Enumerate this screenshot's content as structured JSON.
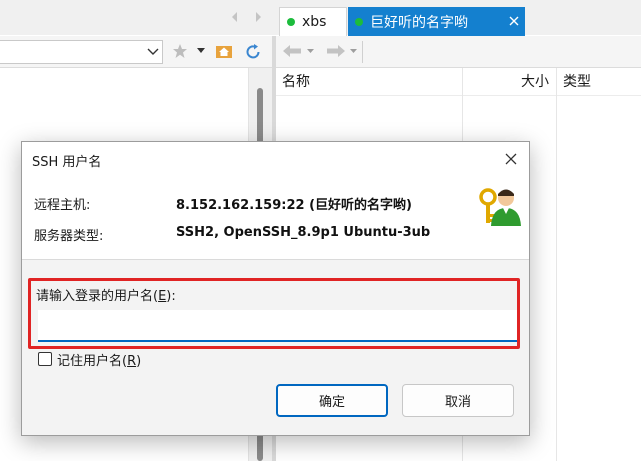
{
  "tabs": [
    {
      "label": "xbs",
      "status_color": "#1cbc3c",
      "active": false
    },
    {
      "label": "巨好听的名字哟",
      "status_color": "#1cbc3c",
      "active": true
    }
  ],
  "right_pane": {
    "columns": [
      "名称",
      "大小",
      "类型"
    ]
  },
  "dialog": {
    "title": "SSH 用户名",
    "host_label": "远程主机:",
    "host_value": "8.152.162.159:22 (巨好听的名字哟)",
    "server_type_label": "服务器类型:",
    "server_type_value": "SSH2, OpenSSH_8.9p1 Ubuntu-3ub",
    "input_label_prefix": "请输入登录的用户名(",
    "input_label_key": "E",
    "input_label_suffix": "):",
    "input_value": "",
    "remember_prefix": "记住用户名(",
    "remember_key": "R",
    "remember_suffix": ")",
    "remember_checked": false,
    "ok_label": "确定",
    "cancel_label": "取消"
  },
  "colors": {
    "accent": "#1480cf",
    "highlight_border": "#e02424",
    "input_focus": "#0067c0"
  },
  "icons": [
    "tab-left-arrow-icon",
    "tab-right-arrow-icon",
    "tab-close-icon",
    "dropdown-arrow-icon",
    "favorites-star-icon",
    "home-folder-icon",
    "refresh-icon",
    "back-arrow-icon",
    "forward-arrow-icon",
    "user-key-icon",
    "close-icon"
  ]
}
